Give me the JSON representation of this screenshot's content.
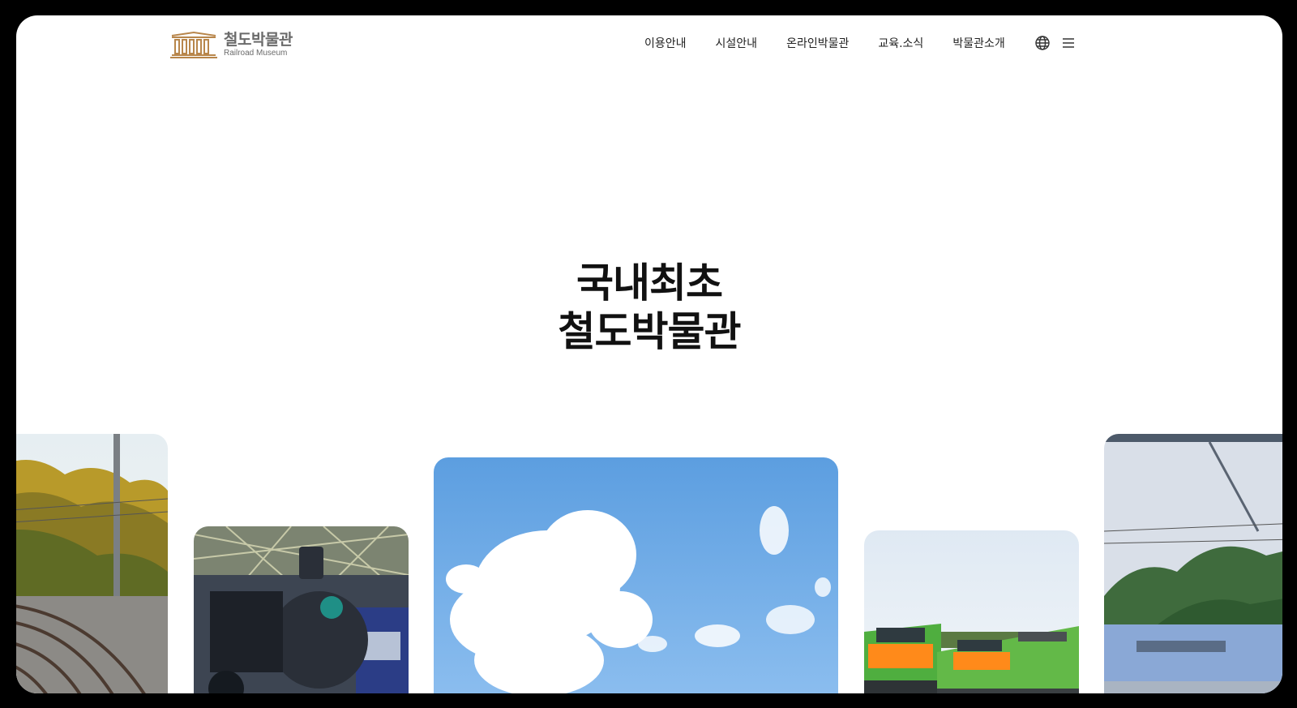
{
  "logo": {
    "name_ko": "철도박물관",
    "name_en": "Railroad Museum",
    "icon": "museum-building-icon",
    "color": "#b8864b"
  },
  "nav": {
    "items": [
      {
        "label": "이용안내"
      },
      {
        "label": "시설안내"
      },
      {
        "label": "온라인박물관"
      },
      {
        "label": "교육.소식"
      },
      {
        "label": "박물관소개"
      }
    ],
    "icons": [
      "globe-icon",
      "menu-icon"
    ]
  },
  "hero": {
    "line1": "국내최초",
    "line2": "철도박물관"
  },
  "gallery": [
    {
      "subject": "curved-railway-tracks"
    },
    {
      "subject": "steam-locomotive"
    },
    {
      "subject": "blue-sky-clouds"
    },
    {
      "subject": "green-orange-trains"
    },
    {
      "subject": "blue-train-overhead-lines"
    }
  ]
}
